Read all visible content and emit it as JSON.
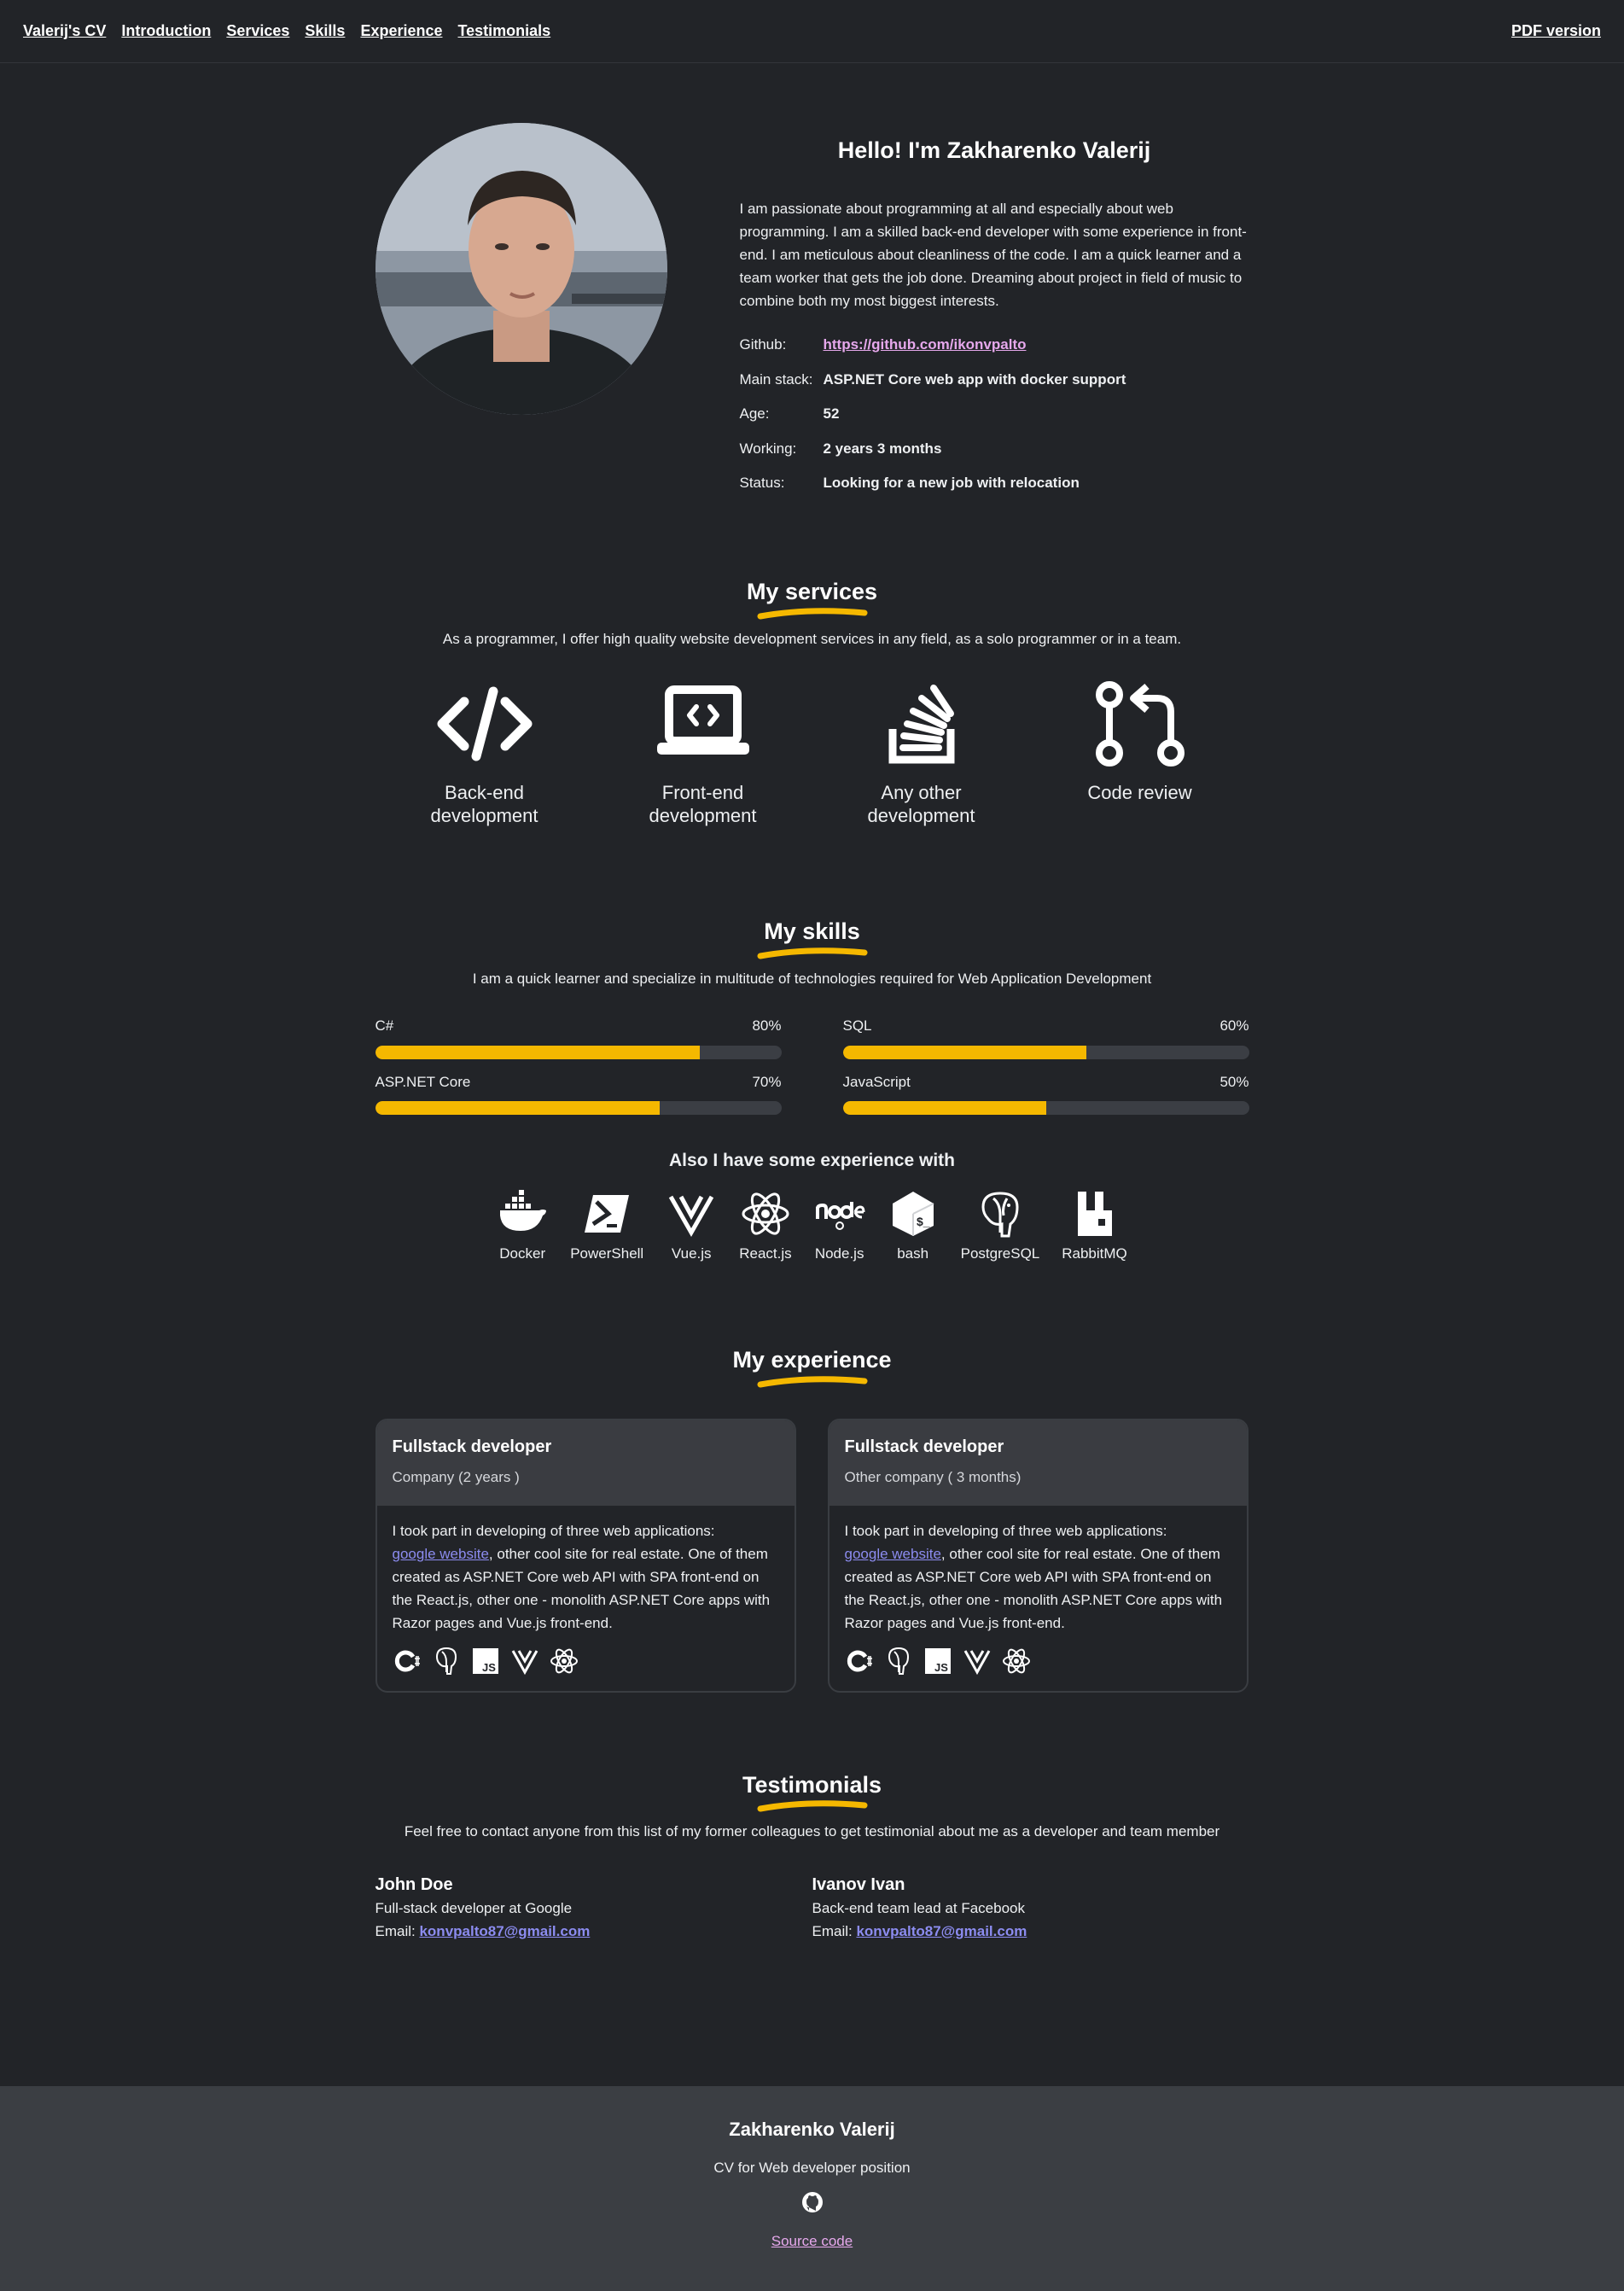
{
  "nav": {
    "brand": "Valerij's CV",
    "links": [
      "Introduction",
      "Services",
      "Skills",
      "Experience",
      "Testimonials"
    ],
    "pdf": "PDF version"
  },
  "hero": {
    "title": "Hello! I'm Zakharenko Valerij",
    "about": "I am passionate about programming at all and especially about web programming. I am a skilled back-end developer with some experience in front-end. I am meticulous about cleanliness of the code. I am a quick learner and a team worker that gets the job done. Dreaming about project in field of music to combine both my most biggest interests.",
    "facts": [
      {
        "k": "Github:",
        "v": "https://github.com/ikonvpalto"
      },
      {
        "k": "Main stack:",
        "v": "ASP.NET Core web app with docker support"
      },
      {
        "k": "Age:",
        "v": "52"
      },
      {
        "k": "Working:",
        "v": "2 years 3 months"
      },
      {
        "k": "Status:",
        "v": "Looking for a new job with relocation"
      }
    ]
  },
  "services": {
    "title": "My services",
    "sub": "As a programmer, I offer high quality website development services in any field, as a solo programmer or in a team.",
    "items": [
      {
        "l1": "Back-end",
        "l2": "development",
        "icon": "code-icon"
      },
      {
        "l1": "Front-end",
        "l2": "development",
        "icon": "laptop-code-icon"
      },
      {
        "l1": "Any other",
        "l2": "development",
        "icon": "stack-overflow-icon"
      },
      {
        "l1": "Code review",
        "l2": "",
        "icon": "git-pull-request-icon"
      }
    ]
  },
  "skills": {
    "title": "My skills",
    "sub": "I am a quick learner and specialize in multitude of technologies required for Web Application Development",
    "items": [
      {
        "name": "C#",
        "pct": "80%",
        "value": 80
      },
      {
        "name": "SQL",
        "pct": "60%",
        "value": 60
      },
      {
        "name": "ASP.NET Core",
        "pct": "70%",
        "value": 70
      },
      {
        "name": "JavaScript",
        "pct": "50%",
        "value": 50
      }
    ],
    "also_title": "Also I have some experience with",
    "tech": [
      "Docker",
      "PowerShell",
      "Vue.js",
      "React.js",
      "Node.js",
      "bash",
      "PostgreSQL",
      "RabbitMQ"
    ]
  },
  "experience": {
    "title": "My experience",
    "cards": [
      {
        "title": "Fullstack developer",
        "sub": "Company (2 years )",
        "link": "google website",
        "text": ", other cool site for real estate. One of them created as ASP.NET Core web API with SPA front-end on the React.js, other one - monolith ASP.NET Core apps with Razor pages and Vue.js front-end.",
        "intro": "I took part in developing of three web applications:"
      },
      {
        "title": "Fullstack developer",
        "sub": "Other company ( 3 months)",
        "link": "google website",
        "text": ", other cool site for real estate. One of them created as ASP.NET Core web API with SPA front-end on the React.js, other one - monolith ASP.NET Core apps with Razor pages and Vue.js front-end.",
        "intro": "I took part in developing of three web applications:"
      }
    ]
  },
  "testimonials": {
    "title": "Testimonials",
    "sub": "Feel free to contact anyone from this list of my former colleagues to get testimonial about me as a developer and team member",
    "people": [
      {
        "name": "John Doe",
        "role": "Full-stack developer at Google",
        "email_label": "Email: ",
        "email": "konvpalto87@gmail.com"
      },
      {
        "name": "Ivanov Ivan",
        "role": "Back-end team lead at Facebook",
        "email_label": "Email: ",
        "email": "konvpalto87@gmail.com"
      }
    ]
  },
  "footer": {
    "name": "Zakharenko Valerij",
    "sub": "CV for Web developer position",
    "link": "Source code"
  },
  "colors": {
    "accent": "#f5b800",
    "bg": "#222428",
    "link": "#e6a8ec"
  }
}
